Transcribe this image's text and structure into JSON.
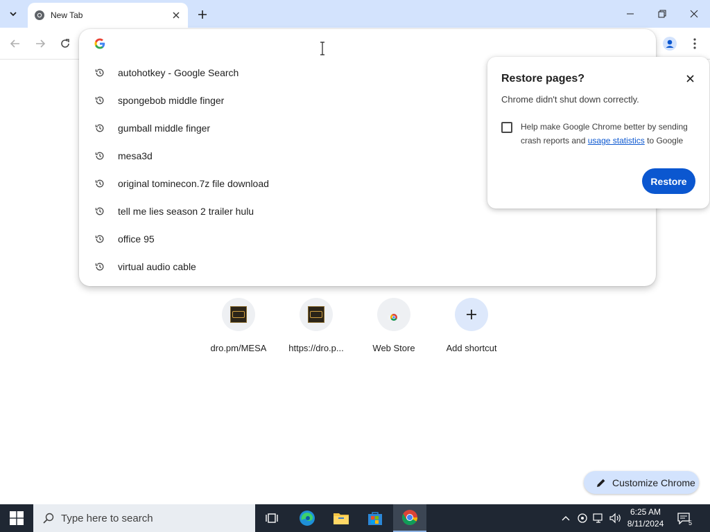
{
  "browser": {
    "tab": {
      "title": "New Tab"
    },
    "omnibox": {
      "value": "",
      "suggestions": [
        {
          "text": "autohotkey - Google Search",
          "icon": "history-icon"
        },
        {
          "text": "spongebob middle finger",
          "icon": "history-icon"
        },
        {
          "text": "gumball middle finger",
          "icon": "history-icon"
        },
        {
          "text": "mesa3d",
          "icon": "history-icon"
        },
        {
          "text": "original tominecon.7z file download",
          "icon": "history-icon"
        },
        {
          "text": "tell me lies season 2 trailer hulu",
          "icon": "history-icon"
        },
        {
          "text": "office 95",
          "icon": "history-icon"
        },
        {
          "text": "virtual audio cable",
          "icon": "history-icon"
        }
      ]
    }
  },
  "restore_bubble": {
    "title": "Restore pages?",
    "message": "Chrome didn't shut down correctly.",
    "checkbox_text_before": "Help make Google Chrome better by sending crash reports and",
    "checkbox_link": "usage statistics",
    "checkbox_text_after": "to Google",
    "checkbox_checked": false,
    "button_label": "Restore"
  },
  "ntp": {
    "shortcuts": [
      {
        "label": "dro.pm/MESA",
        "icon": "site-thumbnail-icon"
      },
      {
        "label": "https://dro.p...",
        "icon": "site-thumbnail-icon"
      },
      {
        "label": "Web Store",
        "icon": "web-store-icon"
      },
      {
        "label": "Add shortcut",
        "icon": "plus-icon"
      }
    ],
    "customize_label": "Customize Chrome"
  },
  "taskbar": {
    "search_placeholder": "Type here to search",
    "time": "6:25 AM",
    "date": "8/11/2024",
    "notification_count": "5"
  },
  "colors": {
    "tabstrip": "#d3e3fd",
    "accent": "#0b57d0",
    "taskbar": "#1f2733"
  }
}
